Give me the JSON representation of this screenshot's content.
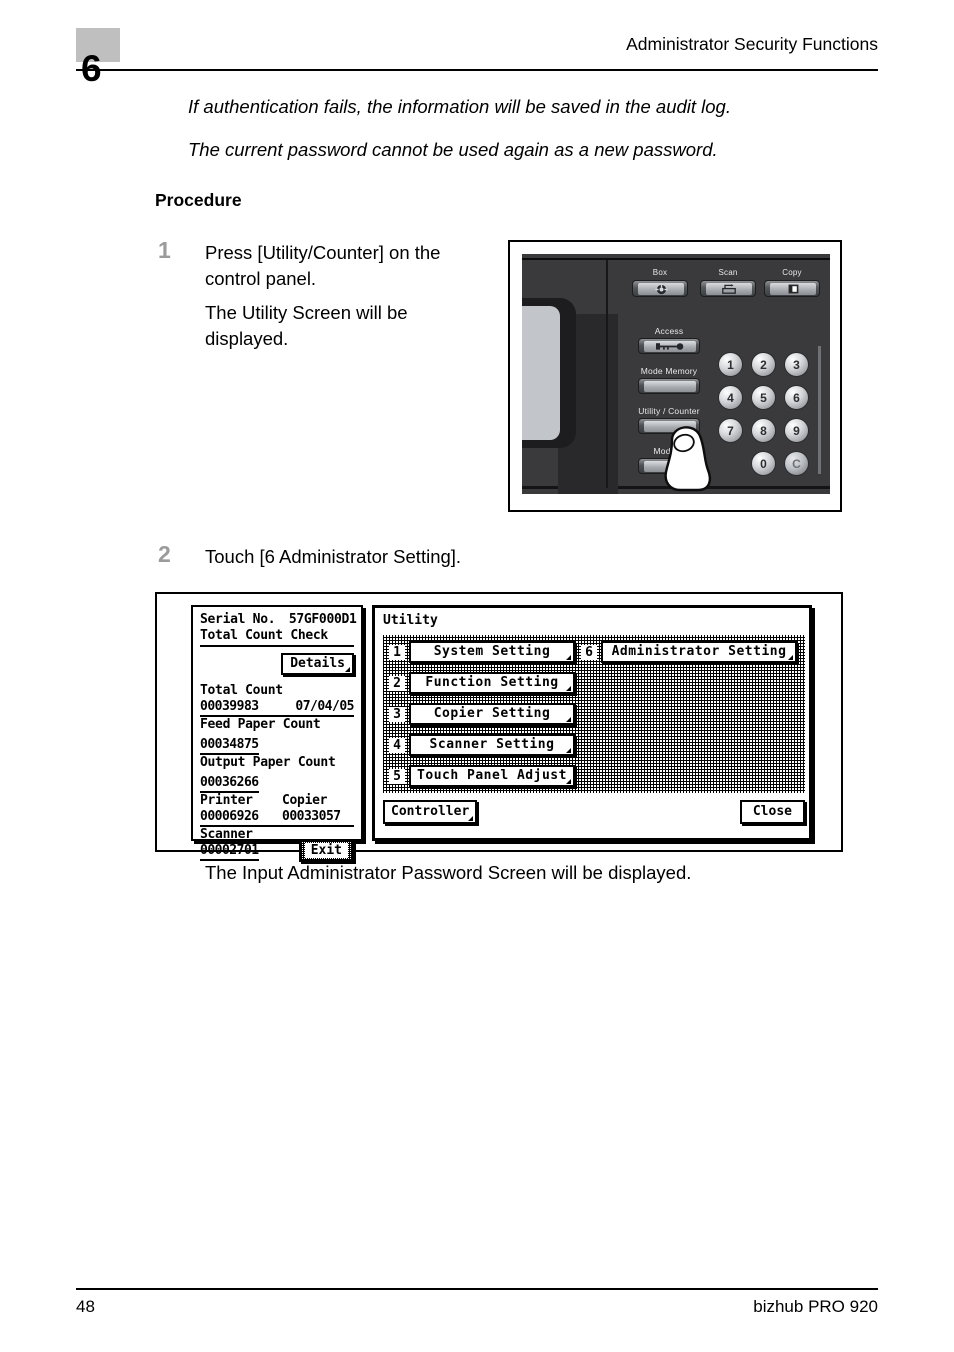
{
  "header": {
    "chapter_number": "6",
    "title": "Administrator Security Functions"
  },
  "body": {
    "intro_line_1": "If authentication fails, the information will be saved in the audit log.",
    "intro_line_2": "The current password cannot be used again as a new password.",
    "procedure_heading": "Procedure"
  },
  "steps": [
    {
      "number": "1",
      "text": "Press [Utility/Counter] on the control panel.",
      "subtext": "The Utility Screen will be displayed."
    },
    {
      "number": "2",
      "text": "Touch [6 Administrator Setting].",
      "caption_after": "The Input Administrator Password Screen will be displayed."
    }
  ],
  "control_panel": {
    "mode_buttons": [
      {
        "label": "Box",
        "icon": "box-icon"
      },
      {
        "label": "Scan",
        "icon": "scan-icon"
      },
      {
        "label": "Copy",
        "icon": "copy-icon"
      }
    ],
    "side_buttons": [
      {
        "label": "Access",
        "icon": "key-icon"
      },
      {
        "label": "Mode Memory",
        "icon": ""
      },
      {
        "label": "Utility / Counter",
        "icon": ""
      },
      {
        "label": "Mode C",
        "icon": ""
      }
    ],
    "keypad": [
      "1",
      "2",
      "3",
      "4",
      "5",
      "6",
      "7",
      "8",
      "9",
      "0",
      "C"
    ],
    "pointing_hand": "finger-icon"
  },
  "utility_screen": {
    "counter_panel": {
      "serial_label": "Serial No.",
      "serial_value": "57GF000D1",
      "check_title": "Total Count Check",
      "details_button": "Details",
      "rows": [
        {
          "label": "Total Count",
          "value": "00039983",
          "extra": "07/04/05"
        },
        {
          "label": "Feed Paper Count",
          "value": "00034875"
        },
        {
          "label": "Output Paper Count",
          "value": "00036266"
        }
      ],
      "printer_label": "Printer",
      "printer_value": "00006926",
      "copier_label": "Copier",
      "copier_value": "00033057",
      "scanner_label": "Scanner",
      "scanner_value": "00002701",
      "exit_button": "Exit"
    },
    "window": {
      "title": "Utility",
      "menu": [
        {
          "index": "1",
          "label": "System Setting"
        },
        {
          "index": "2",
          "label": "Function Setting"
        },
        {
          "index": "3",
          "label": "Copier Setting"
        },
        {
          "index": "4",
          "label": "Scanner Setting"
        },
        {
          "index": "5",
          "label": "Touch Panel Adjust"
        },
        {
          "index": "6",
          "label": "Administrator Setting"
        }
      ],
      "controller_button": "Controller",
      "close_button": "Close"
    }
  },
  "footer": {
    "page_number": "48",
    "model": "bizhub PRO 920"
  },
  "colors": {
    "chapter_badge": "#bfbfbf",
    "step_number": "#9b9b9b",
    "panel_body": "#3a3a3c",
    "text": "#000000"
  }
}
